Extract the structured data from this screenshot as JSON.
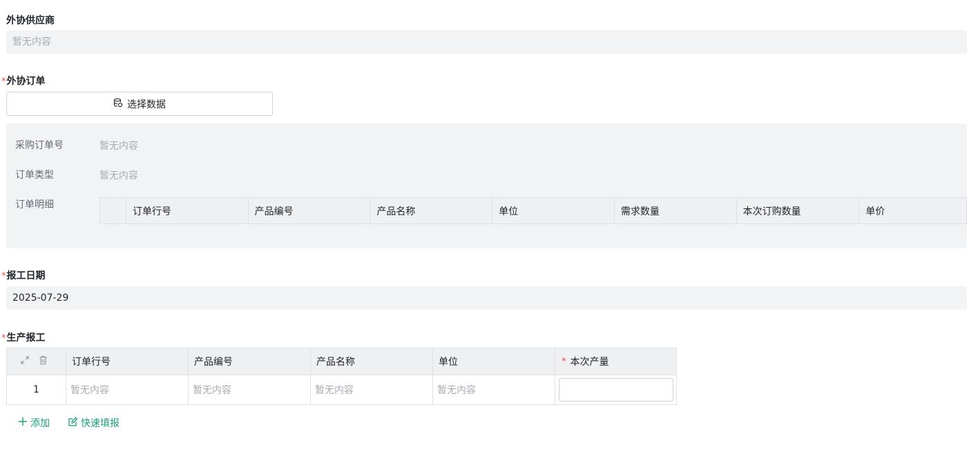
{
  "supplier": {
    "label": "外协供应商",
    "value": "暂无内容"
  },
  "order": {
    "label": "外协订单",
    "select_button": "选择数据",
    "po_label": "采购订单号",
    "po_value": "暂无内容",
    "type_label": "订单类型",
    "type_value": "暂无内容",
    "detail_label": "订单明细",
    "detail_columns": [
      "订单行号",
      "产品编号",
      "产品名称",
      "单位",
      "需求数量",
      "本次订购数量",
      "单价"
    ]
  },
  "report_date": {
    "label": "报工日期",
    "value": "2025-07-29"
  },
  "production": {
    "label": "生产报工",
    "columns": [
      "订单行号",
      "产品编号",
      "产品名称",
      "单位",
      "本次产量"
    ],
    "rows": [
      {
        "index": "1",
        "line_no": "暂无内容",
        "product_code": "暂无内容",
        "product_name": "暂无内容",
        "unit": "暂无内容",
        "qty": ""
      }
    ],
    "add_label": "添加",
    "quick_fill_label": "快速填报"
  },
  "colors": {
    "accent": "#1a9e77",
    "required": "#f54a45",
    "field_bg": "#f2f3f5"
  }
}
